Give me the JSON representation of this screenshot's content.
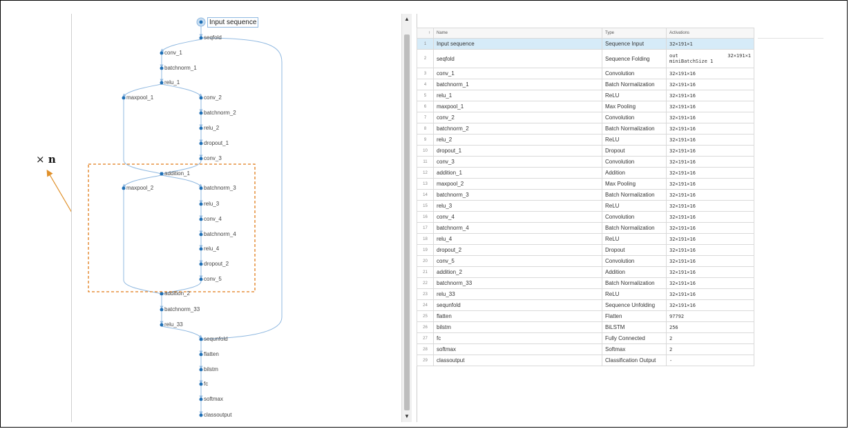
{
  "annotation": {
    "multiplier": "×",
    "variable": "n"
  },
  "graph": {
    "nodes": [
      {
        "id": "input",
        "label": "Input sequence",
        "selected": true
      },
      {
        "id": "seqfold",
        "label": "seqfold"
      },
      {
        "id": "conv_1",
        "label": "conv_1"
      },
      {
        "id": "batchnorm_1",
        "label": "batchnorm_1"
      },
      {
        "id": "relu_1",
        "label": "relu_1"
      },
      {
        "id": "maxpool_1",
        "label": "maxpool_1"
      },
      {
        "id": "conv_2",
        "label": "conv_2"
      },
      {
        "id": "batchnorm_2",
        "label": "batchnorm_2"
      },
      {
        "id": "relu_2",
        "label": "relu_2"
      },
      {
        "id": "dropout_1",
        "label": "dropout_1"
      },
      {
        "id": "conv_3",
        "label": "conv_3"
      },
      {
        "id": "addition_1",
        "label": "addition_1"
      },
      {
        "id": "maxpool_2",
        "label": "maxpool_2"
      },
      {
        "id": "batchnorm_3",
        "label": "batchnorm_3"
      },
      {
        "id": "relu_3",
        "label": "relu_3"
      },
      {
        "id": "conv_4",
        "label": "conv_4"
      },
      {
        "id": "batchnorm_4",
        "label": "batchnorm_4"
      },
      {
        "id": "relu_4",
        "label": "relu_4"
      },
      {
        "id": "dropout_2",
        "label": "dropout_2"
      },
      {
        "id": "conv_5",
        "label": "conv_5"
      },
      {
        "id": "addition_2",
        "label": "addition_2"
      },
      {
        "id": "batchnorm_33",
        "label": "batchnorm_33"
      },
      {
        "id": "relu_33",
        "label": "relu_33"
      },
      {
        "id": "sequnfold",
        "label": "sequnfold"
      },
      {
        "id": "flatten",
        "label": "flatten"
      },
      {
        "id": "bilstm",
        "label": "bilstm"
      },
      {
        "id": "fc",
        "label": "fc"
      },
      {
        "id": "softmax",
        "label": "softmax"
      },
      {
        "id": "classoutput",
        "label": "classoutput"
      }
    ]
  },
  "table": {
    "headers": {
      "sort": "↑",
      "name": "Name",
      "type": "Type",
      "activations": "Activations"
    },
    "rows": [
      {
        "idx": "1",
        "name": "Input sequence",
        "type": "Sequence Input",
        "act": "32×191×1",
        "selected": true
      },
      {
        "idx": "2",
        "name": "seqfold",
        "type": "Sequence Folding",
        "act": "out",
        "act_value": "32×191×1",
        "act2": "miniBatchSize",
        "act2_value": "1"
      },
      {
        "idx": "3",
        "name": "conv_1",
        "type": "Convolution",
        "act": "32×191×16"
      },
      {
        "idx": "4",
        "name": "batchnorm_1",
        "type": "Batch Normalization",
        "act": "32×191×16"
      },
      {
        "idx": "5",
        "name": "relu_1",
        "type": "ReLU",
        "act": "32×191×16"
      },
      {
        "idx": "6",
        "name": "maxpool_1",
        "type": "Max Pooling",
        "act": "32×191×16"
      },
      {
        "idx": "7",
        "name": "conv_2",
        "type": "Convolution",
        "act": "32×191×16"
      },
      {
        "idx": "8",
        "name": "batchnorm_2",
        "type": "Batch Normalization",
        "act": "32×191×16"
      },
      {
        "idx": "9",
        "name": "relu_2",
        "type": "ReLU",
        "act": "32×191×16"
      },
      {
        "idx": "10",
        "name": "dropout_1",
        "type": "Dropout",
        "act": "32×191×16"
      },
      {
        "idx": "11",
        "name": "conv_3",
        "type": "Convolution",
        "act": "32×191×16"
      },
      {
        "idx": "12",
        "name": "addition_1",
        "type": "Addition",
        "act": "32×191×16"
      },
      {
        "idx": "13",
        "name": "maxpool_2",
        "type": "Max Pooling",
        "act": "32×191×16"
      },
      {
        "idx": "14",
        "name": "batchnorm_3",
        "type": "Batch Normalization",
        "act": "32×191×16"
      },
      {
        "idx": "15",
        "name": "relu_3",
        "type": "ReLU",
        "act": "32×191×16"
      },
      {
        "idx": "16",
        "name": "conv_4",
        "type": "Convolution",
        "act": "32×191×16"
      },
      {
        "idx": "17",
        "name": "batchnorm_4",
        "type": "Batch Normalization",
        "act": "32×191×16"
      },
      {
        "idx": "18",
        "name": "relu_4",
        "type": "ReLU",
        "act": "32×191×16"
      },
      {
        "idx": "19",
        "name": "dropout_2",
        "type": "Dropout",
        "act": "32×191×16"
      },
      {
        "idx": "20",
        "name": "conv_5",
        "type": "Convolution",
        "act": "32×191×16"
      },
      {
        "idx": "21",
        "name": "addition_2",
        "type": "Addition",
        "act": "32×191×16"
      },
      {
        "idx": "22",
        "name": "batchnorm_33",
        "type": "Batch Normalization",
        "act": "32×191×16"
      },
      {
        "idx": "23",
        "name": "relu_33",
        "type": "ReLU",
        "act": "32×191×16"
      },
      {
        "idx": "24",
        "name": "sequnfold",
        "type": "Sequence Unfolding",
        "act": "32×191×16"
      },
      {
        "idx": "25",
        "name": "flatten",
        "type": "Flatten",
        "act": "97792"
      },
      {
        "idx": "26",
        "name": "bilstm",
        "type": "BiLSTM",
        "act": "256"
      },
      {
        "idx": "27",
        "name": "fc",
        "type": "Fully Connected",
        "act": "2"
      },
      {
        "idx": "28",
        "name": "softmax",
        "type": "Softmax",
        "act": "2"
      },
      {
        "idx": "29",
        "name": "classoutput",
        "type": "Classification Output",
        "act": "-"
      }
    ]
  },
  "scrollbar": {
    "up_icon": "scroll-up-arrow",
    "down_icon": "scroll-down-arrow"
  },
  "colors": {
    "edge": "#8fb8e0",
    "node": "#1f6fb5",
    "selected_row": "#d6ebf8",
    "dashed_box": "#e07b18",
    "annotation_arrow": "#e0902a"
  }
}
